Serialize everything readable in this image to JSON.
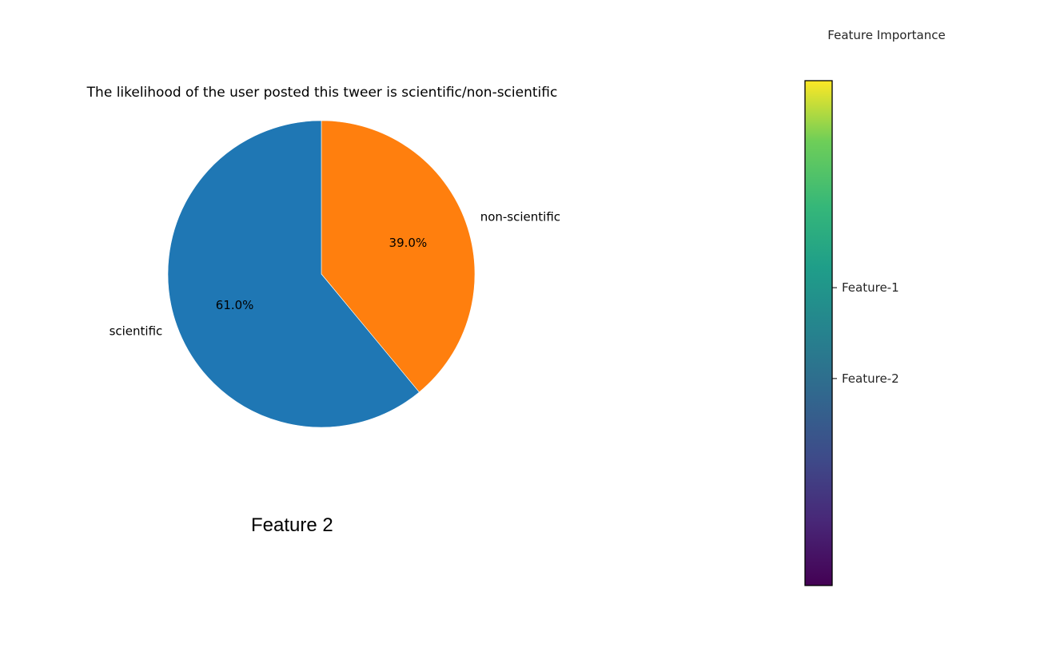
{
  "chart_data": [
    {
      "type": "pie",
      "title": "The likelihood of the user posted  this tweer is scientific/non-scientific",
      "categories": [
        "scientific",
        "non-scientific"
      ],
      "values": [
        61.0,
        39.0
      ],
      "value_labels": [
        "61.0%",
        "39.0%"
      ],
      "colors": [
        "#1f77b4",
        "#ff7f0e"
      ],
      "start": "top, clockwise from non-scientific"
    },
    {
      "type": "heatmap",
      "title": "Feature Importance",
      "colormap": "viridis",
      "tick_labels": [
        "Feature-1",
        "Feature-2"
      ],
      "tick_positions": [
        0.59,
        0.41
      ],
      "colors": [
        "#fde725",
        "#35b779",
        "#21918c",
        "#31688e",
        "#443983",
        "#440154"
      ]
    }
  ],
  "caption": "Feature 2"
}
